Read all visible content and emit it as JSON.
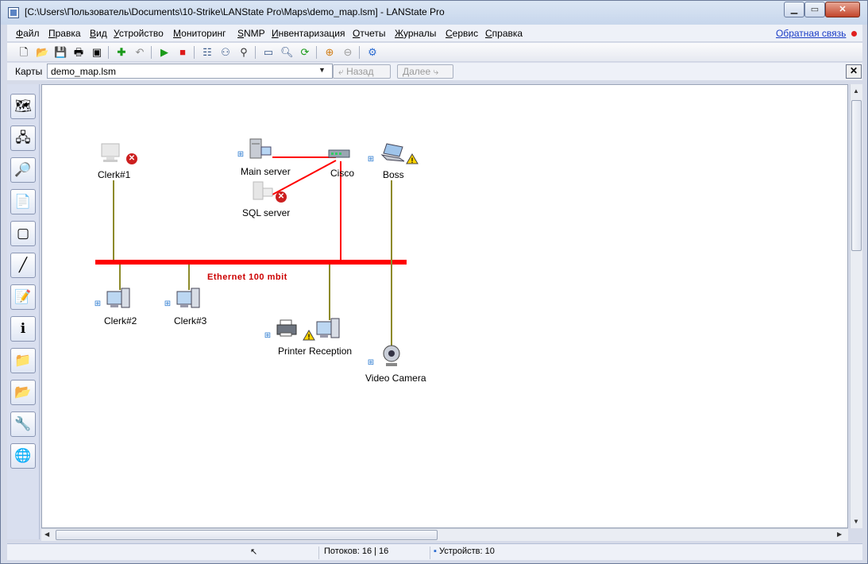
{
  "window": {
    "title": "[C:\\Users\\Пользователь\\Documents\\10-Strike\\LANState Pro\\Maps\\demo_map.lsm] - LANState Pro",
    "minimize": "▁",
    "maximize": "▭",
    "close": "✕"
  },
  "menu": {
    "items": [
      "Файл",
      "Правка",
      "Вид",
      "Устройство",
      "Мониторинг",
      "SNMP",
      "Инвентаризация",
      "Отчеты",
      "Журналы",
      "Сервис",
      "Справка"
    ],
    "feedback": "Обратная связь",
    "feedback_color": "#e02020"
  },
  "addressbar": {
    "label": "Карты",
    "map_file": "demo_map.lsm",
    "back": "Назад",
    "forward": "Далее",
    "close": "✕"
  },
  "map": {
    "segment_label": "Ethernet 100 mbit",
    "segment_color": "#ff0000",
    "link_color": "#8d8a2a",
    "nodes": {
      "clerk1": "Clerk#1",
      "main_server": "Main server",
      "sql_server": "SQL server",
      "cisco": "Cisco",
      "boss": "Boss",
      "clerk2": "Clerk#2",
      "clerk3": "Clerk#3",
      "printer": "Printer",
      "reception": "Reception",
      "video_camera": "Video Camera"
    }
  },
  "status": {
    "threads": "Потоков: 16 | 16",
    "devices": "Устройств: 10"
  }
}
